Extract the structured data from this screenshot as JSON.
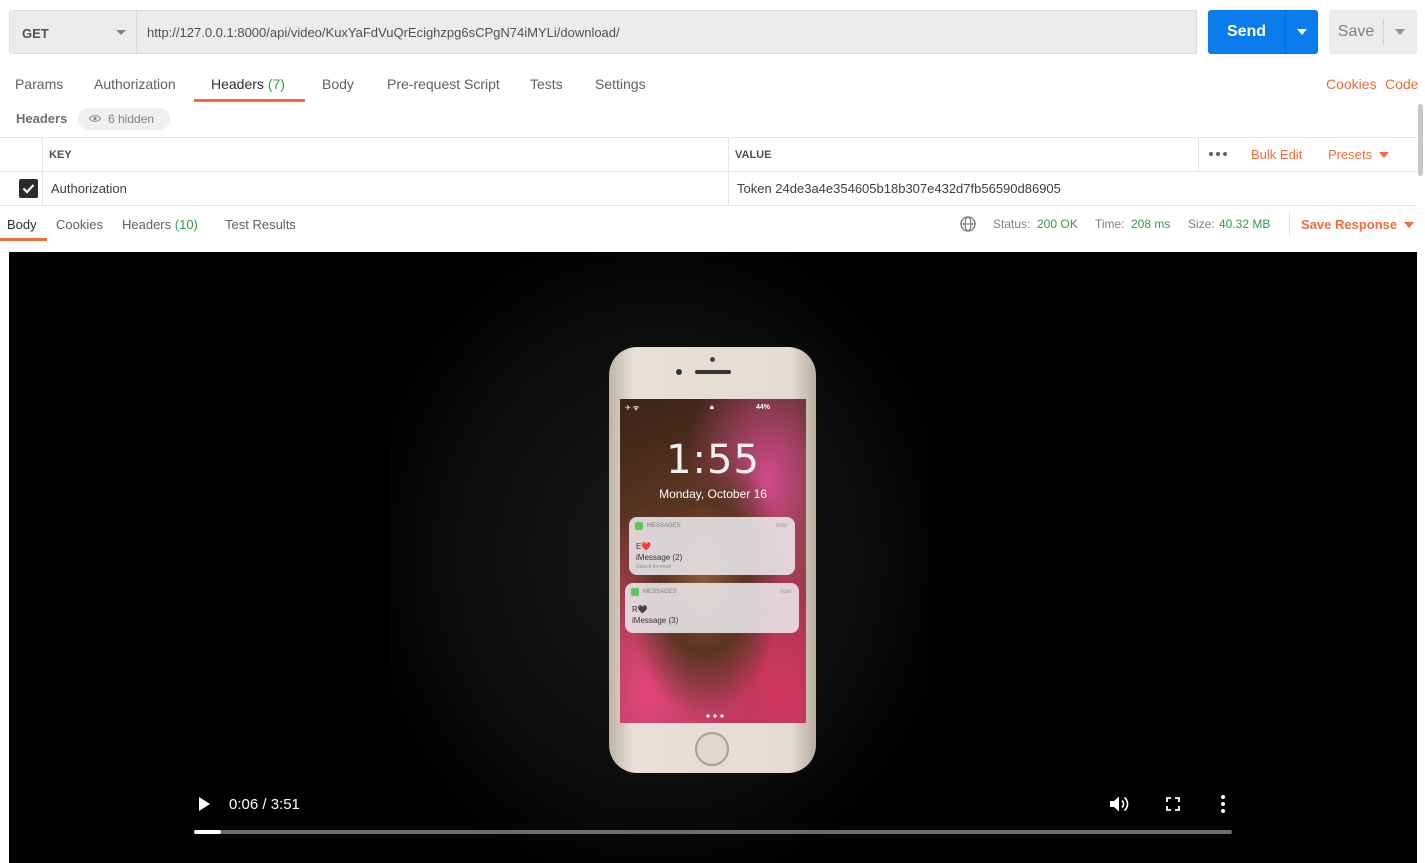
{
  "request": {
    "method": "GET",
    "url": "http://127.0.0.1:8000/api/video/KuxYaFdVuQrEcighzpg6sCPgN74iMYLi/download/",
    "send_label": "Send",
    "save_label": "Save"
  },
  "request_tabs": {
    "params": "Params",
    "authorization": "Authorization",
    "headers": "Headers",
    "headers_count": "(7)",
    "body": "Body",
    "prerequest": "Pre-request Script",
    "tests": "Tests",
    "settings": "Settings",
    "cookies": "Cookies",
    "code": "Code"
  },
  "headers_section": {
    "title": "Headers",
    "hidden_label": "6 hidden",
    "col_key": "KEY",
    "col_value": "VALUE",
    "bulk_edit": "Bulk Edit",
    "presets": "Presets",
    "rows": [
      {
        "checked": true,
        "key": "Authorization",
        "value": "Token 24de3a4e354605b18b307e432d7fb56590d86905"
      }
    ]
  },
  "response": {
    "tabs": {
      "body": "Body",
      "cookies": "Cookies",
      "headers": "Headers",
      "headers_count": "(10)",
      "test_results": "Test Results"
    },
    "status_label": "Status:",
    "status_value": "200 OK",
    "time_label": "Time:",
    "time_value": "208 ms",
    "size_label": "Size:",
    "size_value": "40.32 MB",
    "save_response": "Save Response"
  },
  "video": {
    "time_display": "0:06 / 3:51",
    "progress_fraction": 0.026,
    "phone_screen": {
      "clock": "1:55",
      "date": "Monday, October 16",
      "battery": "44%",
      "notifications": [
        {
          "app": "MESSAGES",
          "time": "now",
          "from": "E❤️",
          "body": "iMessage (2)",
          "hint": "Unlock for more"
        },
        {
          "app": "MESSAGES",
          "time": "now",
          "from": "R🖤",
          "body": "iMessage (3)"
        }
      ]
    }
  },
  "colors": {
    "accent": "#f26b3a",
    "send_blue": "#097bed",
    "success_green": "#2c9e4b"
  }
}
